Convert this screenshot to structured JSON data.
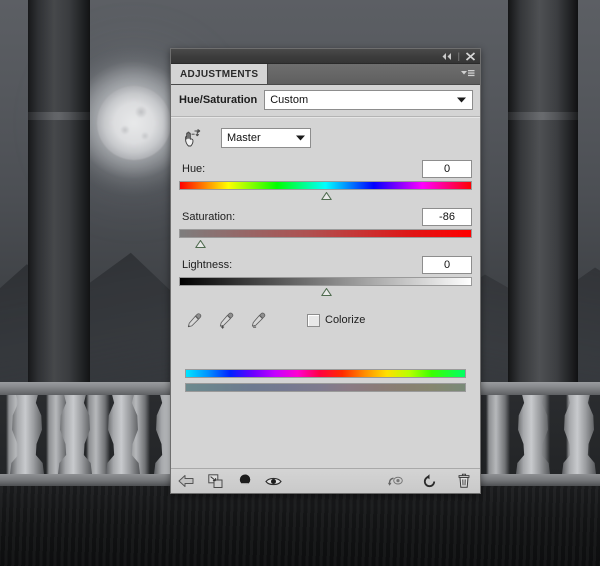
{
  "window": {
    "titlebar": {
      "collapse_icon": "double-left-arrow-icon",
      "close_icon": "close-icon"
    },
    "tab": {
      "label": "ADJUSTMENTS",
      "menu_icon": "panel-menu-icon"
    }
  },
  "adjustment": {
    "title": "Hue/Saturation",
    "preset": {
      "value": "Custom",
      "caret_icon": "chevron-down-icon"
    },
    "targeted_tool_icon": "on-image-adjustment-hand-icon",
    "channel": {
      "value": "Master",
      "caret_icon": "chevron-down-icon"
    }
  },
  "sliders": [
    {
      "name": "hue",
      "label": "Hue:",
      "value": "0",
      "numeric": 0,
      "min": -180,
      "max": 180,
      "handle_percent": 50,
      "track": "rainbow-hue-gradient"
    },
    {
      "name": "saturation",
      "label": "Saturation:",
      "value": "-86",
      "numeric": -86,
      "min": -100,
      "max": 100,
      "handle_percent": 7,
      "track": "gray-to-red-gradient"
    },
    {
      "name": "lightness",
      "label": "Lightness:",
      "value": "0",
      "numeric": 0,
      "min": -100,
      "max": 100,
      "handle_percent": 50,
      "track": "black-to-white-gradient"
    }
  ],
  "tools": {
    "eyedroppers": [
      {
        "name": "eyedropper-sample-icon",
        "modifier": ""
      },
      {
        "name": "eyedropper-add-icon",
        "modifier": "+"
      },
      {
        "name": "eyedropper-subtract-icon",
        "modifier": "−"
      }
    ],
    "colorize": {
      "label": "Colorize",
      "checked": false
    }
  },
  "color_bars": {
    "top_label": "original-hue-spectrum",
    "bottom_label": "adjusted-hue-spectrum"
  },
  "bottom_toolbar": {
    "left": [
      {
        "name": "return-to-adjustment-list-icon"
      },
      {
        "name": "clip-to-layer-icon"
      },
      {
        "name": "new-adjustment-preset-icon"
      },
      {
        "name": "toggle-layer-visibility-icon"
      }
    ],
    "right": [
      {
        "name": "preview-previous-state-icon"
      },
      {
        "name": "reset-adjustment-icon"
      },
      {
        "name": "delete-adjustment-layer-icon"
      }
    ]
  }
}
